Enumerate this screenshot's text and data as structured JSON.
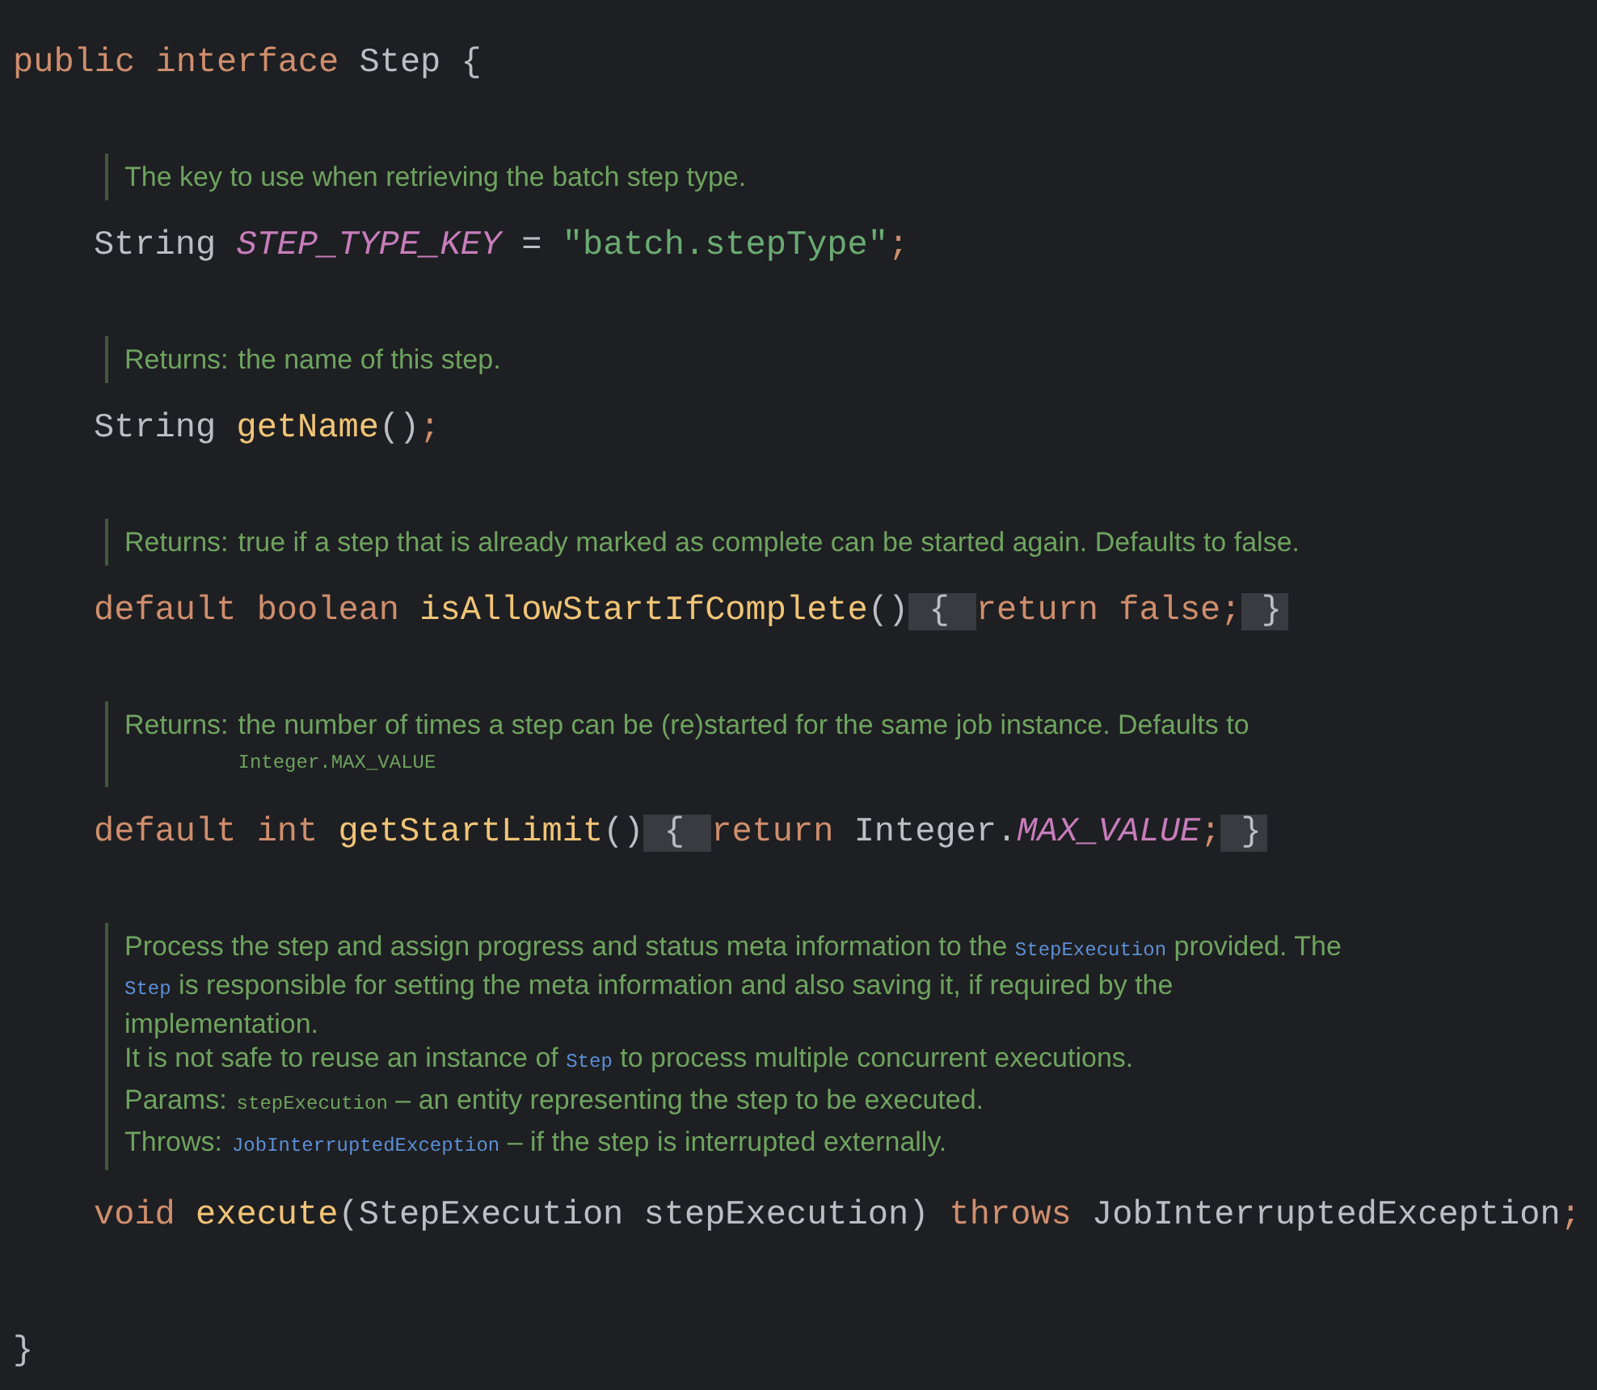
{
  "header": [
    {
      "kind": "keyword",
      "text": "public interface "
    },
    {
      "kind": "plain",
      "text": "Step {"
    }
  ],
  "members": [
    {
      "kind": "doc",
      "rows": [
        {
          "lines": [
            [
              {
                "kind": "text",
                "text": "The key to use when retrieving the batch step type."
              }
            ]
          ]
        }
      ]
    },
    {
      "kind": "line",
      "tokens": [
        {
          "kind": "plain",
          "text": "String "
        },
        {
          "kind": "constant",
          "text": "STEP_TYPE_KEY"
        },
        {
          "kind": "plain",
          "text": " = "
        },
        {
          "kind": "string",
          "text": "\"batch.stepType\""
        },
        {
          "kind": "keyword",
          "text": ";"
        }
      ]
    },
    {
      "kind": "doc",
      "rows": [
        {
          "label": "Returns:",
          "lines": [
            [
              {
                "kind": "text",
                "text": "the name of this step."
              }
            ]
          ]
        }
      ]
    },
    {
      "kind": "line",
      "tokens": [
        {
          "kind": "plain",
          "text": "String "
        },
        {
          "kind": "method",
          "text": "getName"
        },
        {
          "kind": "plain",
          "text": "()"
        },
        {
          "kind": "keyword",
          "text": ";"
        }
      ]
    },
    {
      "kind": "doc",
      "rows": [
        {
          "label": "Returns:",
          "lines": [
            [
              {
                "kind": "text",
                "text": "true if a step that is already marked as complete can be started again. Defaults to false."
              }
            ]
          ]
        }
      ]
    },
    {
      "kind": "line",
      "tokens": [
        {
          "kind": "keyword",
          "text": "default boolean "
        },
        {
          "kind": "method",
          "text": "isAllowStartIfComplete"
        },
        {
          "kind": "plain",
          "text": "()"
        },
        {
          "kind": "fold",
          "text": " { "
        },
        {
          "kind": "keyword",
          "text": "return false;"
        },
        {
          "kind": "fold",
          "text": " }"
        }
      ]
    },
    {
      "kind": "doc",
      "rows": [
        {
          "label": "Returns:",
          "lines": [
            [
              {
                "kind": "text",
                "text": "the number of times a step can be (re)started for the same job instance. Defaults to"
              }
            ],
            [
              {
                "kind": "code",
                "text": "Integer.MAX_VALUE"
              }
            ]
          ]
        }
      ]
    },
    {
      "kind": "line",
      "tokens": [
        {
          "kind": "keyword",
          "text": "default int "
        },
        {
          "kind": "method",
          "text": "getStartLimit"
        },
        {
          "kind": "plain",
          "text": "()"
        },
        {
          "kind": "fold",
          "text": " { "
        },
        {
          "kind": "keyword",
          "text": "return "
        },
        {
          "kind": "plain",
          "text": "Integer."
        },
        {
          "kind": "constant",
          "text": "MAX_VALUE"
        },
        {
          "kind": "keyword",
          "text": ";"
        },
        {
          "kind": "fold",
          "text": " }"
        }
      ]
    },
    {
      "kind": "doc",
      "rows": [
        {
          "lines": [
            [
              {
                "kind": "text",
                "text": "Process the step and assign progress and status meta information to the "
              },
              {
                "kind": "link",
                "text": "StepExecution"
              },
              {
                "kind": "text",
                "text": " provided. The"
              }
            ],
            [
              {
                "kind": "link",
                "text": "Step"
              },
              {
                "kind": "text",
                "text": " is responsible for setting the meta information and also saving it, if required by the"
              }
            ],
            [
              {
                "kind": "text",
                "text": "implementation."
              }
            ],
            [
              {
                "kind": "text",
                "text": "It is not safe to reuse an instance of "
              },
              {
                "kind": "link",
                "text": "Step"
              },
              {
                "kind": "text",
                "text": " to process multiple concurrent executions."
              }
            ]
          ]
        },
        {
          "label": "Params:",
          "lines": [
            [
              {
                "kind": "code",
                "text": "stepExecution"
              },
              {
                "kind": "text",
                "text": " – an entity representing the step to be executed."
              }
            ]
          ]
        },
        {
          "label": "Throws:",
          "lines": [
            [
              {
                "kind": "link",
                "text": "JobInterruptedException"
              },
              {
                "kind": "text",
                "text": " – if the step is interrupted externally."
              }
            ]
          ]
        }
      ]
    },
    {
      "kind": "line",
      "tokens": [
        {
          "kind": "keyword",
          "text": "void "
        },
        {
          "kind": "method",
          "text": "execute"
        },
        {
          "kind": "plain",
          "text": "(StepExecution stepExecution) "
        },
        {
          "kind": "keyword",
          "text": "throws "
        },
        {
          "kind": "plain",
          "text": "JobInterruptedException"
        },
        {
          "kind": "keyword",
          "text": ";"
        }
      ]
    }
  ],
  "footer": [
    {
      "kind": "plain",
      "text": "}"
    }
  ]
}
